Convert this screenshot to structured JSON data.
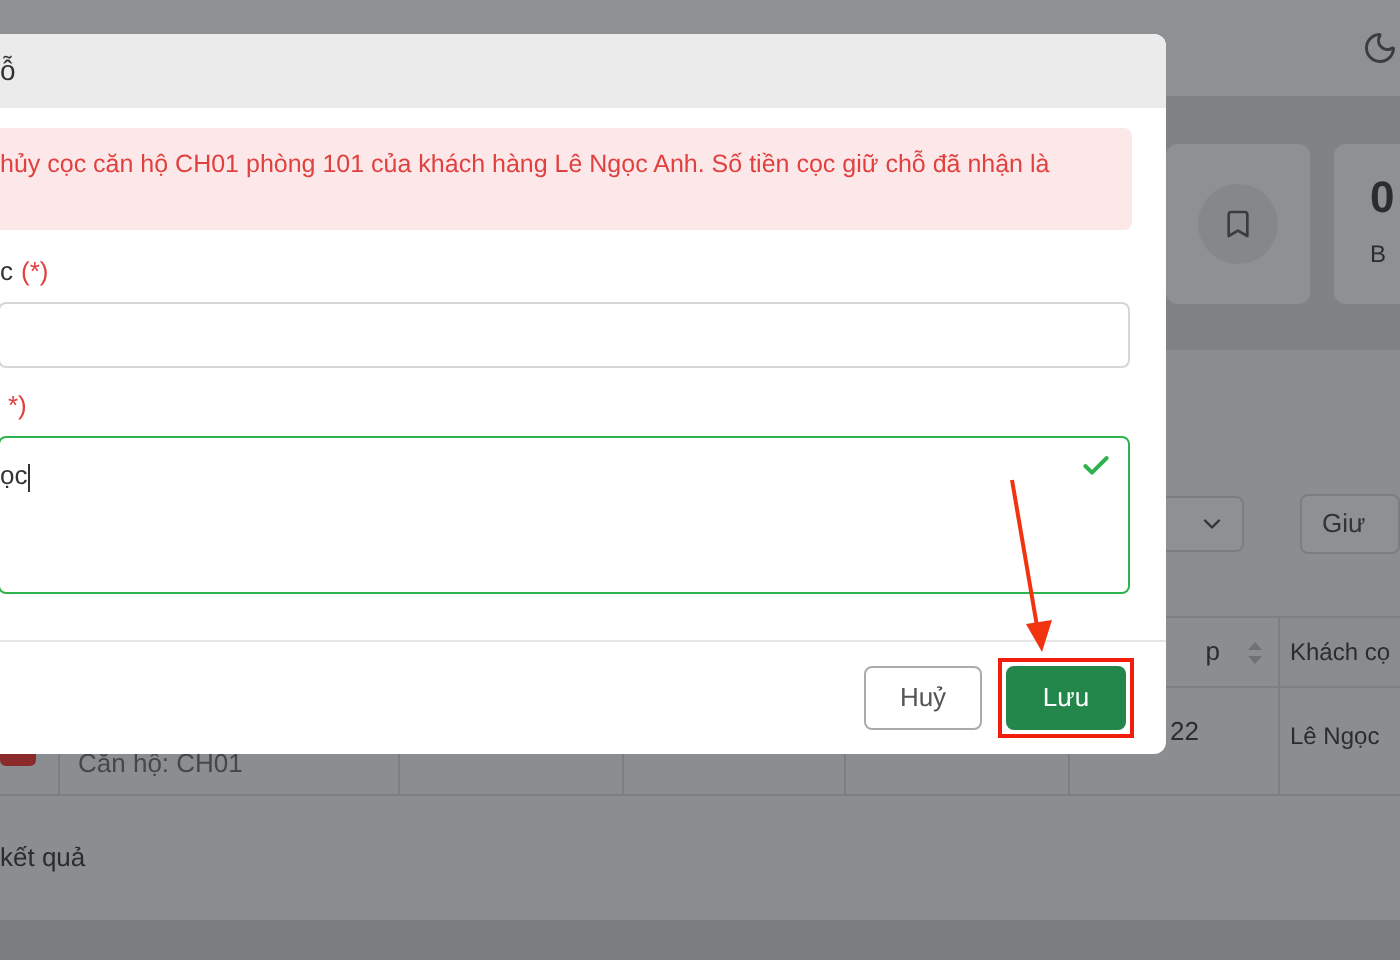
{
  "page": {
    "stat_cards": [
      {
        "kind": "icon"
      },
      {
        "kind": "value",
        "value": "0",
        "label": "B"
      }
    ],
    "filter_button": "Giư",
    "table": {
      "columns": [
        {
          "label": "p",
          "sortable": true
        },
        {
          "label": "Khách cọ",
          "sortable": false
        }
      ],
      "row": {
        "unit": "Căn hộ: CH01",
        "date": "22",
        "customer": "Lê Ngọc"
      }
    },
    "results": "kết quả"
  },
  "dialog": {
    "title": "ỗ",
    "alert": "hủy cọc căn hộ CH01 phòng 101 của khách hàng Lê Ngọc Anh. Số tiền cọc giữ chỗ đã nhận là",
    "fields": [
      {
        "kind": "input",
        "label": "c",
        "required": "(*)",
        "valid": false
      },
      {
        "kind": "textarea",
        "required": "*)",
        "value": "ọc",
        "valid": true
      }
    ],
    "buttons": [
      {
        "kind": "secondary",
        "label": "Huỷ",
        "highlighted": false
      },
      {
        "kind": "primary",
        "label": "Lưu",
        "highlighted": true
      }
    ]
  }
}
